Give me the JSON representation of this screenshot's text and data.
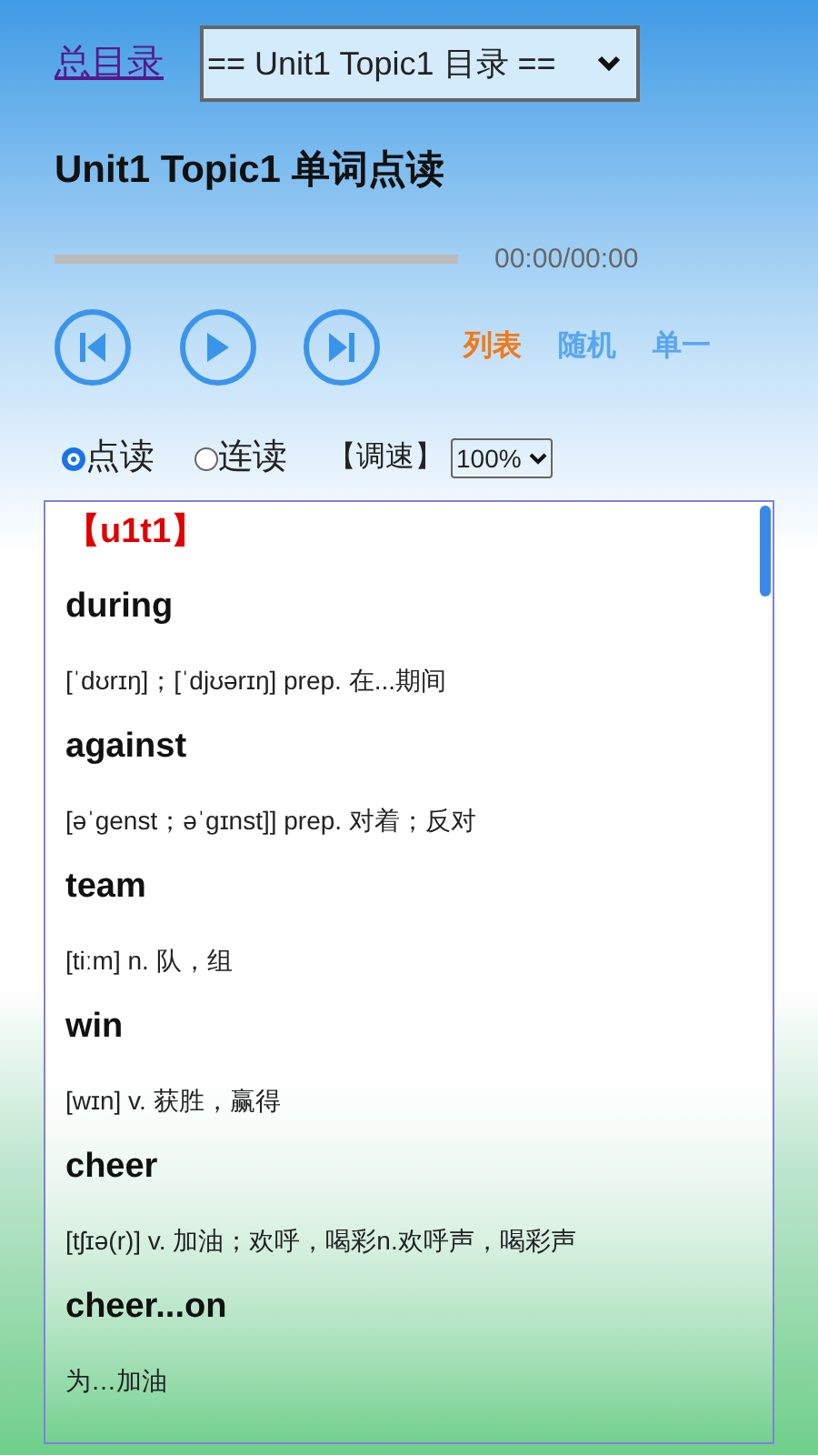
{
  "nav": {
    "home_link": "总目录",
    "topic_select": "== Unit1 Topic1 目录 =="
  },
  "title": "Unit1 Topic1 单词点读",
  "player": {
    "level": 0,
    "time": "00:00/00:00"
  },
  "play_modes": [
    {
      "label": "列表",
      "selected": true
    },
    {
      "label": "随机",
      "selected": false
    },
    {
      "label": "单一",
      "selected": false
    }
  ],
  "read_modes": [
    {
      "label": "点读",
      "selected": true
    },
    {
      "label": "连读",
      "selected": false
    }
  ],
  "speed": {
    "label": "【调速】",
    "value": "100%"
  },
  "word_list": {
    "section": "【u1t1】",
    "entries": [
      {
        "word": "during",
        "definition": "[ˈdʊrɪŋ]；[ˈdjʊərɪŋ] prep. 在...期间"
      },
      {
        "word": "against",
        "definition": "[əˈgenst；əˈgɪnst]] prep. 对着；反对"
      },
      {
        "word": "team",
        "definition": "[tiːm] n. 队，组"
      },
      {
        "word": "win",
        "definition": "[wɪn] v. 获胜，赢得"
      },
      {
        "word": "cheer",
        "definition": "[tʃɪə(r)] v. 加油；欢呼，喝彩n.欢呼声，喝彩声"
      },
      {
        "word": "cheer...on",
        "definition": "为…加油"
      }
    ]
  }
}
